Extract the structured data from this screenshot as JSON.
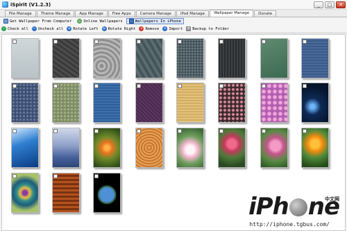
{
  "window": {
    "title": "iSpirit (V1.2.3)",
    "minimize": "_",
    "maximize": "□",
    "close": "✕"
  },
  "tabs": [
    {
      "label": "File Manage"
    },
    {
      "label": "Theme Manage"
    },
    {
      "label": "App Manage"
    },
    {
      "label": "Free Apps"
    },
    {
      "label": "Camera Manage"
    },
    {
      "label": "iPod Manage"
    },
    {
      "label": "Wallpaper Manage"
    },
    {
      "label": "Donate"
    }
  ],
  "sources": [
    {
      "label": "Get Wallpaper From Computer",
      "icon": "computer-icon"
    },
    {
      "label": "Online Wallpapers",
      "icon": "globe-icon"
    },
    {
      "label": "Wallpapers In iPhone",
      "icon": "phone-icon"
    }
  ],
  "toolbar": [
    {
      "label": "Check all",
      "icon": "check-icon",
      "glyph": "✓"
    },
    {
      "label": "Uncheck all",
      "icon": "uncheck-icon",
      "glyph": "–"
    },
    {
      "label": "Rotate Left",
      "icon": "rotate-left-icon",
      "glyph": "↺"
    },
    {
      "label": "Rotate Right",
      "icon": "rotate-right-icon",
      "glyph": "↻"
    },
    {
      "label": "Remove",
      "icon": "remove-icon",
      "glyph": "✕"
    },
    {
      "label": "Import",
      "icon": "import-icon",
      "glyph": "+"
    },
    {
      "label": "Backup to Folder",
      "icon": "backup-icon",
      "glyph": "▤"
    }
  ],
  "watermark": {
    "brand_pre": "iPh",
    "brand_post": "ne",
    "cn": "中文网",
    "url": "http://iphone.tgbus.com/"
  }
}
